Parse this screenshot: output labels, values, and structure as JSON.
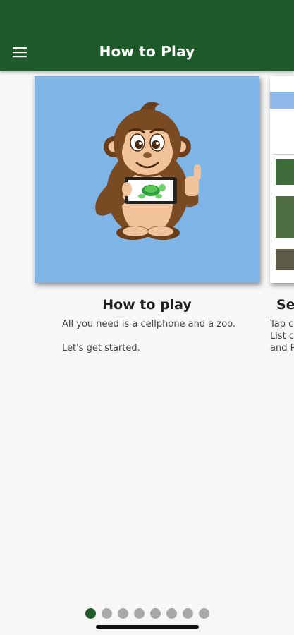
{
  "app_bar": {
    "title": "How to Play",
    "menu_icon": "hamburger-menu-icon",
    "background": "#1f5a2a"
  },
  "cards": [
    {
      "heading": "How to play",
      "lines": [
        "All you need is a cellphone and a zoo.",
        "Let's get started."
      ],
      "image_icon": "monkey-holding-phone-with-turtle-illustration",
      "image_background": "#7fb5e6"
    },
    {
      "heading": "Se",
      "lines": [
        "Tap  c",
        "List  c",
        "and P"
      ],
      "image_icon": "app-list-screenshot"
    }
  ],
  "pager": {
    "count": 8,
    "active_index": 0,
    "active_color": "#1f5a2a",
    "inactive_color": "#a9a9a9"
  }
}
